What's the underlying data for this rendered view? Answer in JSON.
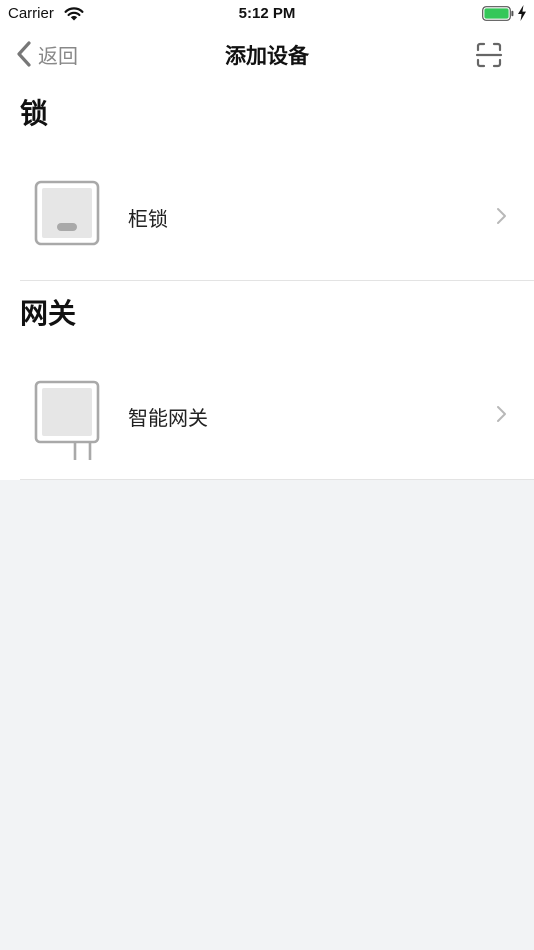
{
  "status_bar": {
    "carrier": "Carrier",
    "time": "5:12 PM",
    "icons": [
      "wifi-icon",
      "battery-icon",
      "charging-bolt-icon"
    ],
    "battery_color": "#34c759"
  },
  "nav": {
    "back_label": "返回",
    "title": "添加设备",
    "back_icon": "chevron-left-icon",
    "scan_icon": "scan-icon"
  },
  "sections": [
    {
      "title": "锁",
      "devices": [
        {
          "name": "柜锁",
          "icon": "cabinet-lock-icon"
        }
      ]
    },
    {
      "title": "网关",
      "devices": [
        {
          "name": "智能网关",
          "icon": "smart-gateway-icon"
        }
      ]
    }
  ],
  "colors": {
    "background": "#f2f3f5",
    "surface": "#ffffff",
    "icon_stroke": "#a9a9a9",
    "icon_fill": "#e6e6e6",
    "muted_text": "#888888"
  }
}
